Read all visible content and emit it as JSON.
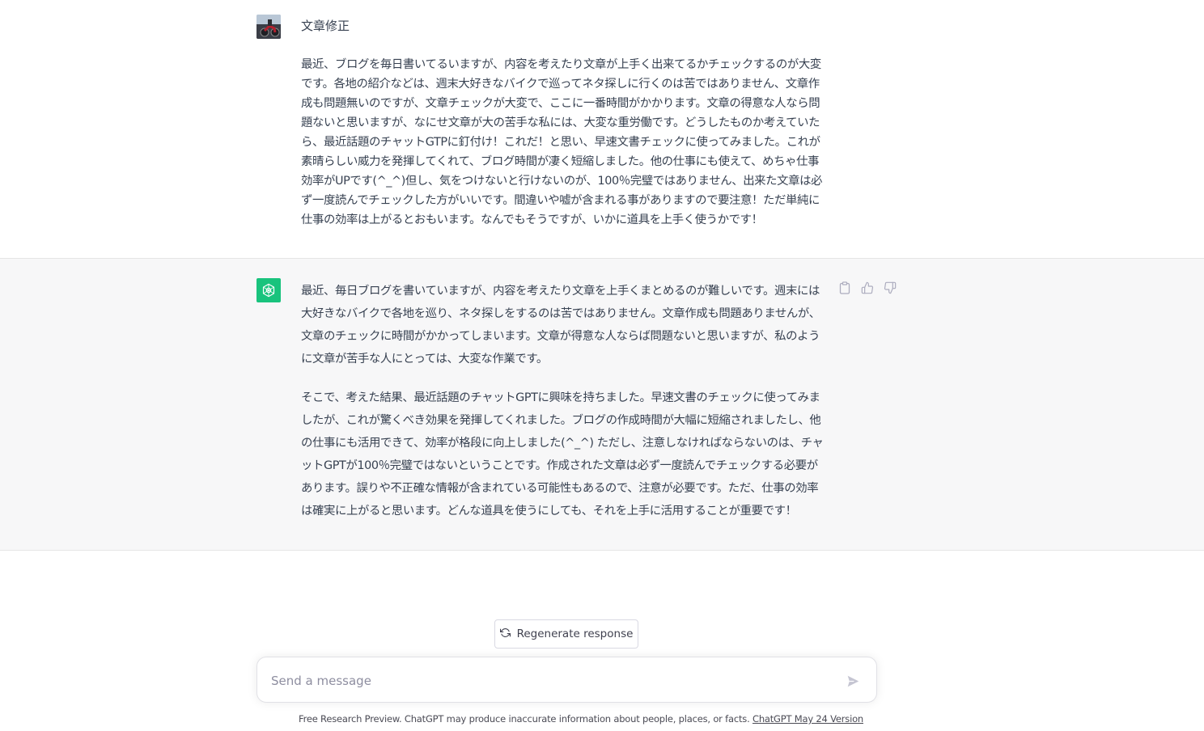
{
  "user_message": {
    "title": "文章修正",
    "body": "最近、ブログを毎日書いてるいますが、内容を考えたり文章が上手く出来てるかチェックするのが大変です。各地の紹介などは、週末大好きなバイクで巡ってネタ探しに行くのは苦ではありません、文章作成も問題無いのですが、文章チェックが大変で、ここに一番時間がかかります。文章の得意な人なら問題ないと思いますが、なにせ文章が大の苦手な私には、大変な重労働です。どうしたものか考えていたら、最近話題のチャットGTPに釘付け！これだ！と思い、早速文書チェックに使ってみました。これが素晴らしい威力を発揮してくれて、ブログ時間が凄く短縮しました。他の仕事にも使えて、めちゃ仕事効率がUPです(^_^)但し、気をつけないと行けないのが、100％完璧ではありません、出来た文章は必ず一度読んでチェックした方がいいです。間違いや嘘が含まれる事がありますので要注意！ただ単純に仕事の効率は上がるとおもいます。なんでもそうですが、いかに道具を上手く使うかです！"
  },
  "assistant_message": {
    "paragraphs": [
      "最近、毎日ブログを書いていますが、内容を考えたり文章を上手くまとめるのが難しいです。週末には大好きなバイクで各地を巡り、ネタ探しをするのは苦ではありません。文章作成も問題ありませんが、文章のチェックに時間がかかってしまいます。文章が得意な人ならば問題ないと思いますが、私のように文章が苦手な人にとっては、大変な作業です。",
      "そこで、考えた結果、最近話題のチャットGPTに興味を持ちました。早速文書のチェックに使ってみましたが、これが驚くべき効果を発揮してくれました。ブログの作成時間が大幅に短縮されましたし、他の仕事にも活用できて、効率が格段に向上しました(^_^) ただし、注意しなければならないのは、チャットGPTが100％完璧ではないということです。作成された文章は必ず一度読んでチェックする必要があります。誤りや不正確な情報が含まれている可能性もあるので、注意が必要です。ただ、仕事の効率は確実に上がると思います。どんな道具を使うにしても、それを上手に活用することが重要です！"
    ],
    "actions": [
      "clipboard-icon",
      "thumbs-up-icon",
      "thumbs-down-icon"
    ]
  },
  "regenerate": {
    "label": "Regenerate response",
    "icon": "refresh-icon"
  },
  "composer": {
    "placeholder": "Send a message",
    "value": ""
  },
  "footer": {
    "text": "Free Research Preview. ChatGPT may produce inaccurate information about people, places, or facts. ",
    "link": "ChatGPT May 24 Version"
  },
  "colors": {
    "assistant_bg": "#f7f7f8",
    "brand_green": "#19c37d",
    "text": "#374151",
    "placeholder": "#8e8ea0"
  }
}
